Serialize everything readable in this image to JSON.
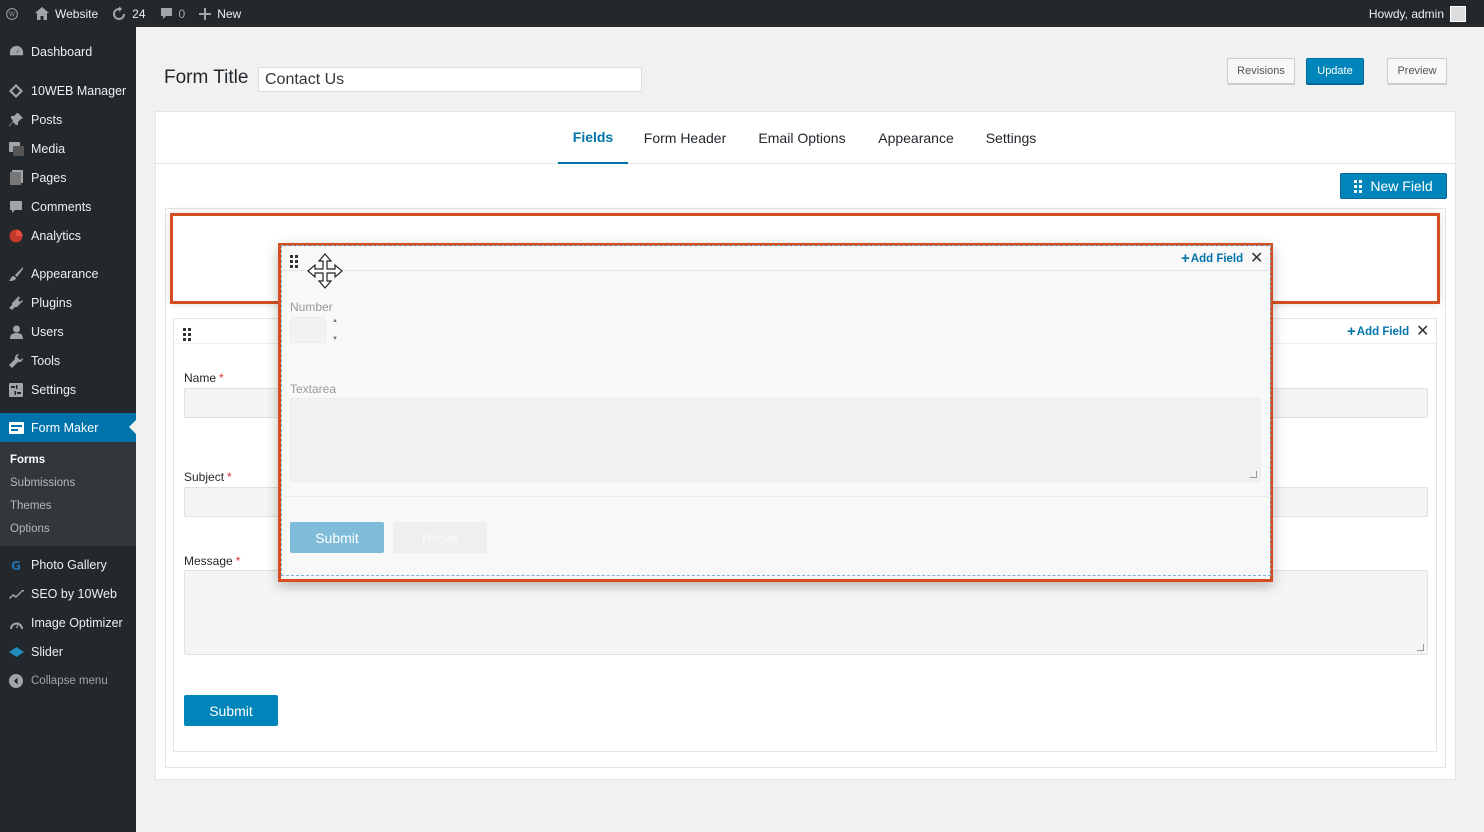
{
  "admin_bar": {
    "site_name": "Website",
    "updates_count": "24",
    "comments_count": "0",
    "new_label": "New",
    "greeting": "Howdy, admin"
  },
  "sidebar": {
    "items": [
      {
        "label": "Dashboard",
        "icon": "dashboard-icon"
      },
      {
        "label": "10WEB Manager",
        "icon": "tenweb-icon"
      },
      {
        "label": "Posts",
        "icon": "pin-icon"
      },
      {
        "label": "Media",
        "icon": "media-icon"
      },
      {
        "label": "Pages",
        "icon": "pages-icon"
      },
      {
        "label": "Comments",
        "icon": "comment-icon"
      },
      {
        "label": "Analytics",
        "icon": "analytics-icon"
      },
      {
        "label": "Appearance",
        "icon": "brush-icon"
      },
      {
        "label": "Plugins",
        "icon": "plugin-icon"
      },
      {
        "label": "Users",
        "icon": "user-icon"
      },
      {
        "label": "Tools",
        "icon": "wrench-icon"
      },
      {
        "label": "Settings",
        "icon": "settings-icon"
      },
      {
        "label": "Form Maker",
        "icon": "form-maker-icon"
      }
    ],
    "submenu": [
      "Forms",
      "Submissions",
      "Themes",
      "Options"
    ],
    "items_after": [
      {
        "label": "Photo Gallery",
        "icon": "gallery-icon"
      },
      {
        "label": "SEO by 10Web",
        "icon": "seo-icon"
      },
      {
        "label": "Image Optimizer",
        "icon": "optimizer-icon"
      },
      {
        "label": "Slider",
        "icon": "slider-icon"
      }
    ],
    "collapse_label": "Collapse menu"
  },
  "header": {
    "form_title_label": "Form Title",
    "form_title_value": "Contact Us",
    "revisions_label": "Revisions",
    "update_label": "Update",
    "preview_label": "Preview"
  },
  "tabs": [
    "Fields",
    "Form Header",
    "Email Options",
    "Appearance",
    "Settings"
  ],
  "new_field_label": "New Field",
  "section": {
    "add_field_label": "Add Field",
    "fields": [
      {
        "label": "Name",
        "required": "*"
      },
      {
        "label": "Subject",
        "required": "*"
      },
      {
        "label": "Message",
        "required": "*"
      }
    ],
    "submit_label": "Submit"
  },
  "dragged_section": {
    "add_field_label": "Add Field",
    "number_label": "Number",
    "textarea_label": "Textarea",
    "submit_label": "Submit",
    "reset_label": "Reset"
  },
  "colors": {
    "accent": "#0073aa",
    "button": "#0085ba",
    "highlight_border": "#d54e21",
    "sidebar_bg": "#23282d"
  }
}
